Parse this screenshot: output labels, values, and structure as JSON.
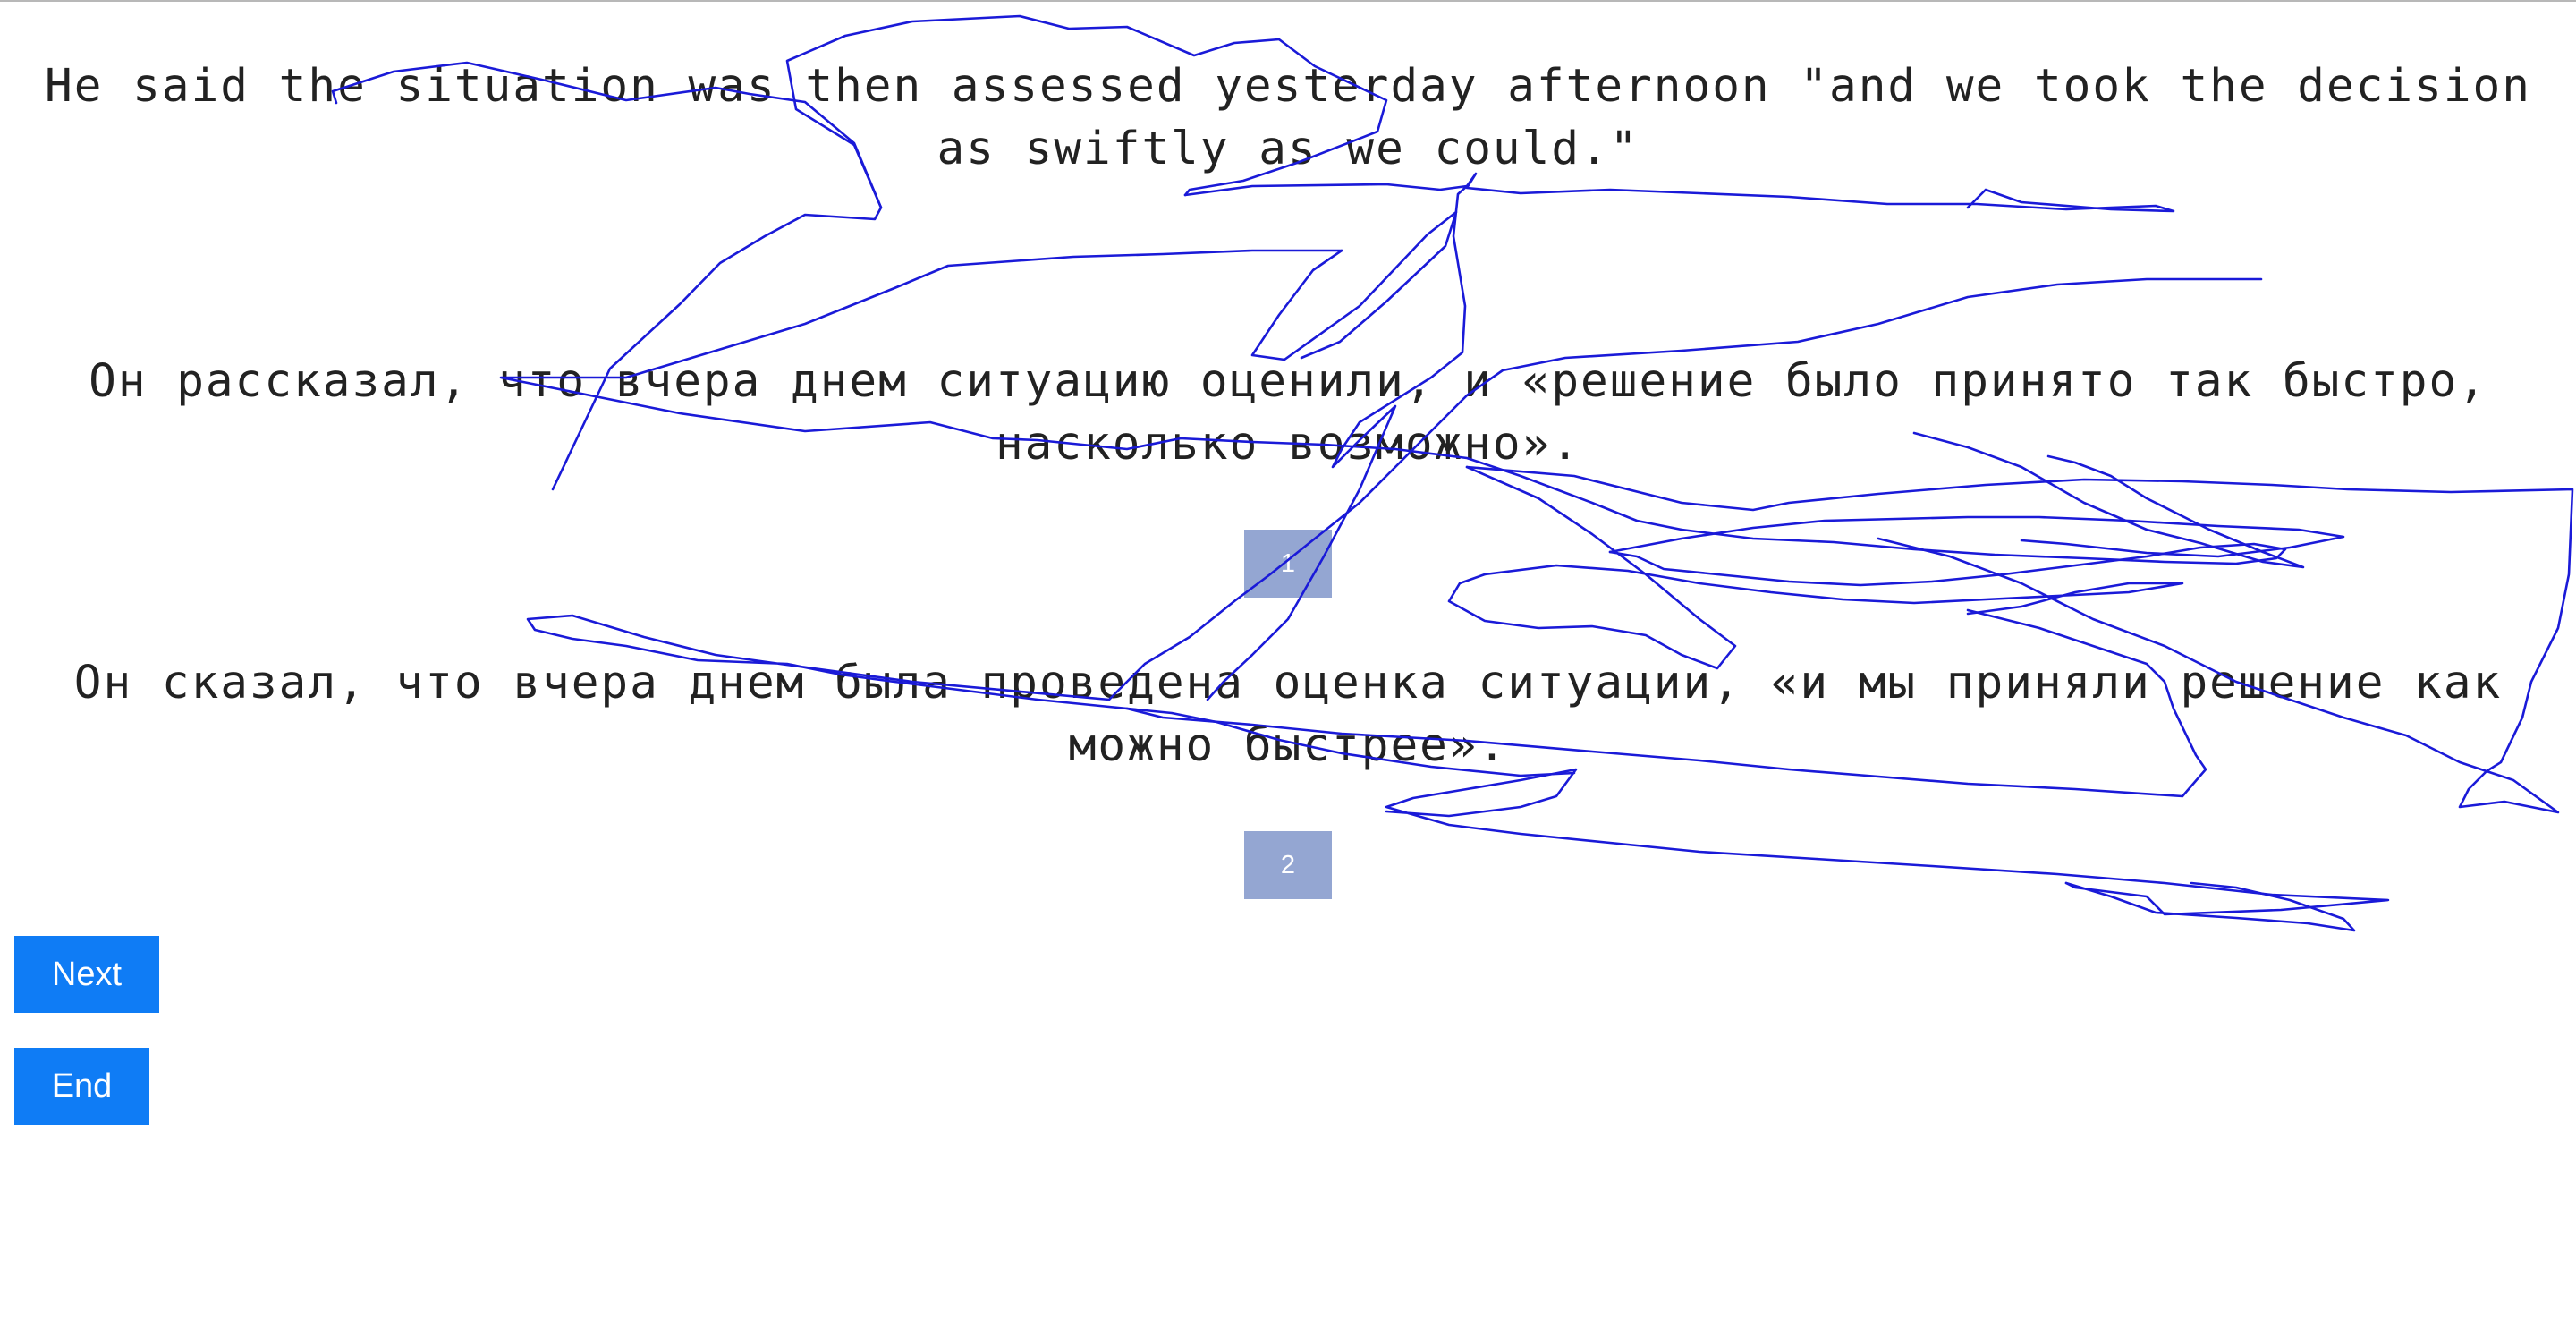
{
  "source_sentence": "He said the situation was then assessed yesterday afternoon \"and we took the decision as swiftly as we could.\"",
  "candidates": [
    {
      "text": "Он рассказал, что вчера днем ситуацию оценили, и «решение было принято так быстро, насколько возможно».",
      "choice_label": "1"
    },
    {
      "text": "Он сказал, что вчера днем была проведена оценка ситуации, «и мы приняли решение как можно быстрее».",
      "choice_label": "2"
    }
  ],
  "buttons": {
    "next_label": "Next",
    "end_label": "End"
  },
  "colors": {
    "choice_button": "#94a6d2",
    "action_button": "#0f7cf5",
    "scribble_stroke": "#1a1ad8"
  }
}
